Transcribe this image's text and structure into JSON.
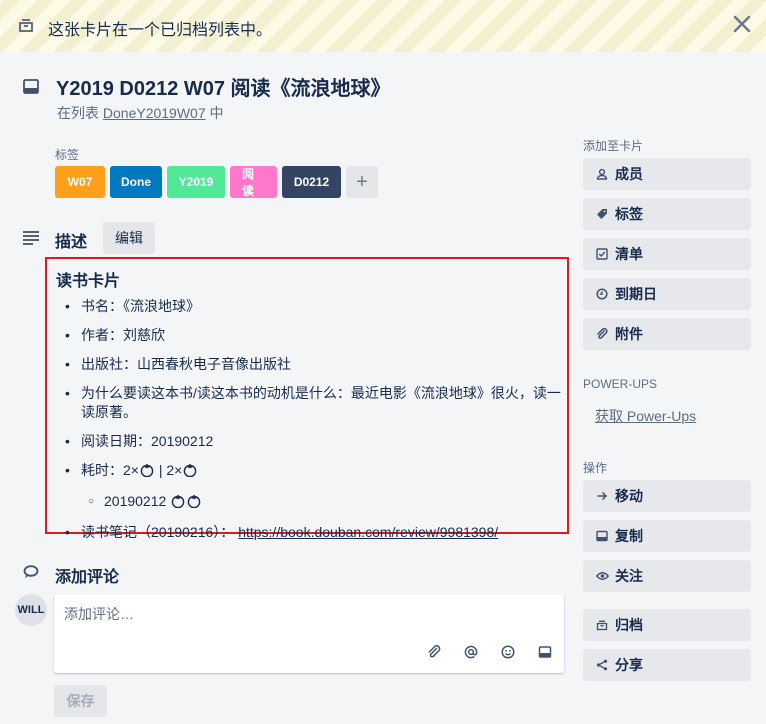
{
  "banner": {
    "text": "这张卡片在一个已归档列表中。"
  },
  "card": {
    "title": "Y2019 D0212 W07 阅读《流浪地球》",
    "list_prefix": "在列表 ",
    "list_name": "DoneY2019W07",
    "list_suffix": " 中"
  },
  "labels": {
    "heading": "标签",
    "items": [
      {
        "text": "W07",
        "color": "#ff9f1a"
      },
      {
        "text": "Done",
        "color": "#0079bf"
      },
      {
        "text": "Y2019",
        "color": "#51e898"
      },
      {
        "text": "阅读",
        "color": "#ff78cb"
      },
      {
        "text": "D0212",
        "color": "#344563"
      }
    ],
    "add": "+"
  },
  "description": {
    "heading": "描述",
    "edit_label": "编辑",
    "title": "读书卡片",
    "book": "书名：《流浪地球》",
    "author": "作者：刘慈欣",
    "publisher": "出版社：山西春秋电子音像出版社",
    "reason": "为什么要读这本书/读这本书的动机是什么：最近电影《流浪地球》很火，读一读原著。",
    "date": "阅读日期：20190212",
    "time_prefix": "耗时：2×",
    "time_mid": " | 2×",
    "sub_date": "20190212 ",
    "notes_prefix": "读书笔记（20190216）： ",
    "notes_link": "https://book.douban.com/review/9981398/"
  },
  "comments": {
    "heading": "添加评论",
    "avatar": "WILL",
    "placeholder": "添加评论…",
    "save_label": "保存"
  },
  "sidebar": {
    "add_heading": "添加至卡片",
    "members": "成员",
    "labels": "标签",
    "checklist": "清单",
    "due_date": "到期日",
    "attachment": "附件",
    "powerups_heading": "POWER-UPS",
    "powerups_link": "获取 Power-Ups",
    "actions_heading": "操作",
    "move": "移动",
    "copy": "复制",
    "watch": "关注",
    "archive": "归档",
    "share": "分享"
  }
}
